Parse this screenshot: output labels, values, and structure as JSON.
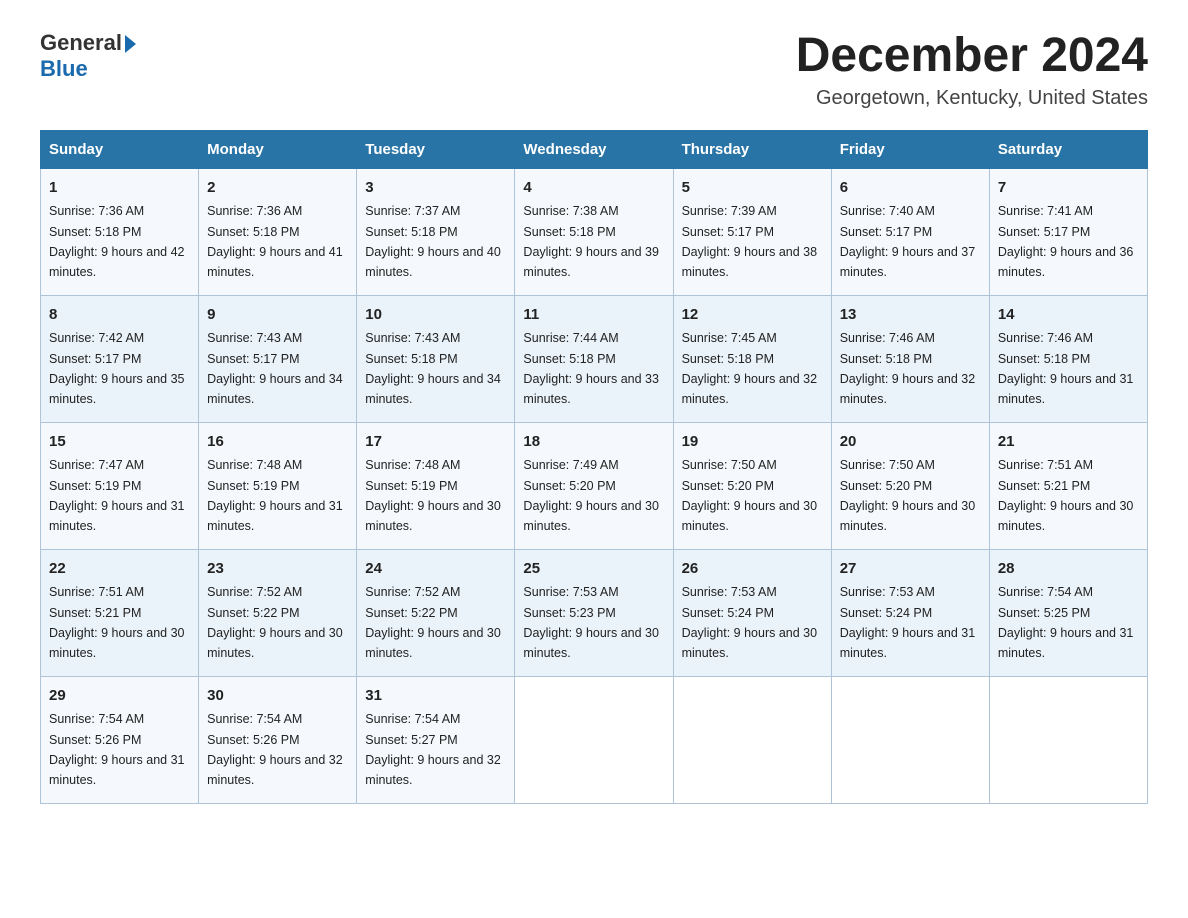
{
  "header": {
    "logo_general": "General",
    "logo_blue": "Blue",
    "month_title": "December 2024",
    "location": "Georgetown, Kentucky, United States"
  },
  "days_of_week": [
    "Sunday",
    "Monday",
    "Tuesday",
    "Wednesday",
    "Thursday",
    "Friday",
    "Saturday"
  ],
  "weeks": [
    [
      {
        "day": "1",
        "sunrise": "7:36 AM",
        "sunset": "5:18 PM",
        "daylight": "9 hours and 42 minutes."
      },
      {
        "day": "2",
        "sunrise": "7:36 AM",
        "sunset": "5:18 PM",
        "daylight": "9 hours and 41 minutes."
      },
      {
        "day": "3",
        "sunrise": "7:37 AM",
        "sunset": "5:18 PM",
        "daylight": "9 hours and 40 minutes."
      },
      {
        "day": "4",
        "sunrise": "7:38 AM",
        "sunset": "5:18 PM",
        "daylight": "9 hours and 39 minutes."
      },
      {
        "day": "5",
        "sunrise": "7:39 AM",
        "sunset": "5:17 PM",
        "daylight": "9 hours and 38 minutes."
      },
      {
        "day": "6",
        "sunrise": "7:40 AM",
        "sunset": "5:17 PM",
        "daylight": "9 hours and 37 minutes."
      },
      {
        "day": "7",
        "sunrise": "7:41 AM",
        "sunset": "5:17 PM",
        "daylight": "9 hours and 36 minutes."
      }
    ],
    [
      {
        "day": "8",
        "sunrise": "7:42 AM",
        "sunset": "5:17 PM",
        "daylight": "9 hours and 35 minutes."
      },
      {
        "day": "9",
        "sunrise": "7:43 AM",
        "sunset": "5:17 PM",
        "daylight": "9 hours and 34 minutes."
      },
      {
        "day": "10",
        "sunrise": "7:43 AM",
        "sunset": "5:18 PM",
        "daylight": "9 hours and 34 minutes."
      },
      {
        "day": "11",
        "sunrise": "7:44 AM",
        "sunset": "5:18 PM",
        "daylight": "9 hours and 33 minutes."
      },
      {
        "day": "12",
        "sunrise": "7:45 AM",
        "sunset": "5:18 PM",
        "daylight": "9 hours and 32 minutes."
      },
      {
        "day": "13",
        "sunrise": "7:46 AM",
        "sunset": "5:18 PM",
        "daylight": "9 hours and 32 minutes."
      },
      {
        "day": "14",
        "sunrise": "7:46 AM",
        "sunset": "5:18 PM",
        "daylight": "9 hours and 31 minutes."
      }
    ],
    [
      {
        "day": "15",
        "sunrise": "7:47 AM",
        "sunset": "5:19 PM",
        "daylight": "9 hours and 31 minutes."
      },
      {
        "day": "16",
        "sunrise": "7:48 AM",
        "sunset": "5:19 PM",
        "daylight": "9 hours and 31 minutes."
      },
      {
        "day": "17",
        "sunrise": "7:48 AM",
        "sunset": "5:19 PM",
        "daylight": "9 hours and 30 minutes."
      },
      {
        "day": "18",
        "sunrise": "7:49 AM",
        "sunset": "5:20 PM",
        "daylight": "9 hours and 30 minutes."
      },
      {
        "day": "19",
        "sunrise": "7:50 AM",
        "sunset": "5:20 PM",
        "daylight": "9 hours and 30 minutes."
      },
      {
        "day": "20",
        "sunrise": "7:50 AM",
        "sunset": "5:20 PM",
        "daylight": "9 hours and 30 minutes."
      },
      {
        "day": "21",
        "sunrise": "7:51 AM",
        "sunset": "5:21 PM",
        "daylight": "9 hours and 30 minutes."
      }
    ],
    [
      {
        "day": "22",
        "sunrise": "7:51 AM",
        "sunset": "5:21 PM",
        "daylight": "9 hours and 30 minutes."
      },
      {
        "day": "23",
        "sunrise": "7:52 AM",
        "sunset": "5:22 PM",
        "daylight": "9 hours and 30 minutes."
      },
      {
        "day": "24",
        "sunrise": "7:52 AM",
        "sunset": "5:22 PM",
        "daylight": "9 hours and 30 minutes."
      },
      {
        "day": "25",
        "sunrise": "7:53 AM",
        "sunset": "5:23 PM",
        "daylight": "9 hours and 30 minutes."
      },
      {
        "day": "26",
        "sunrise": "7:53 AM",
        "sunset": "5:24 PM",
        "daylight": "9 hours and 30 minutes."
      },
      {
        "day": "27",
        "sunrise": "7:53 AM",
        "sunset": "5:24 PM",
        "daylight": "9 hours and 31 minutes."
      },
      {
        "day": "28",
        "sunrise": "7:54 AM",
        "sunset": "5:25 PM",
        "daylight": "9 hours and 31 minutes."
      }
    ],
    [
      {
        "day": "29",
        "sunrise": "7:54 AM",
        "sunset": "5:26 PM",
        "daylight": "9 hours and 31 minutes."
      },
      {
        "day": "30",
        "sunrise": "7:54 AM",
        "sunset": "5:26 PM",
        "daylight": "9 hours and 32 minutes."
      },
      {
        "day": "31",
        "sunrise": "7:54 AM",
        "sunset": "5:27 PM",
        "daylight": "9 hours and 32 minutes."
      },
      null,
      null,
      null,
      null
    ]
  ]
}
